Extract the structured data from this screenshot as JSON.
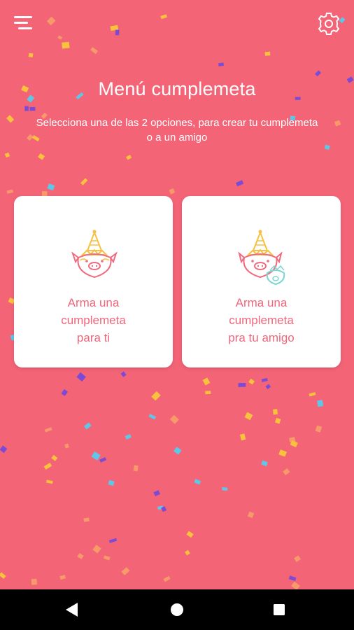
{
  "header": {
    "menu_icon": "menu-lines-icon",
    "settings_icon": "gear-icon"
  },
  "main": {
    "title": "Menú cumplemeta",
    "subtitle_line1": "Selecciona una de las 2 opciones, para crear tu cumplemeta",
    "subtitle_line2": "o a un amigo"
  },
  "options": [
    {
      "line1": "Arma una",
      "line2": "cumplemeta",
      "line3": "para ti",
      "icon": "crowned-pig-party-hat-icon"
    },
    {
      "line1": "Arma una",
      "line2": "cumplemeta",
      "line3": "pra tu amigo",
      "icon": "crowned-pig-with-friend-icon"
    }
  ],
  "colors": {
    "background": "#f46477",
    "card": "#ffffff",
    "card_text": "#f0667a",
    "icon_gold": "#f5c142",
    "icon_pink": "#f06b7e",
    "icon_teal": "#7fd6d0",
    "confetti": [
      "#f8c23c",
      "#7b4bd6",
      "#f79a6a",
      "#5ec7e8"
    ]
  },
  "system_nav": {
    "back_icon": "back-triangle-icon",
    "home_icon": "home-circle-icon",
    "recents_icon": "recents-square-icon"
  }
}
